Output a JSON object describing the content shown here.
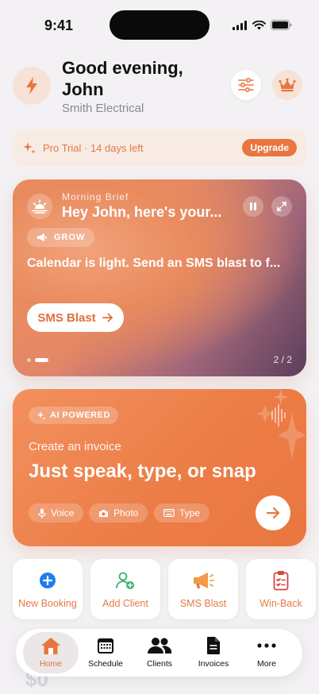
{
  "status": {
    "time": "9:41"
  },
  "header": {
    "greeting": "Good evening, John",
    "company": "Smith Electrical"
  },
  "trial": {
    "text": "Pro Trial · 14 days left",
    "upgrade": "Upgrade"
  },
  "brief": {
    "label": "Morning Brief",
    "title": "Hey John, here's your...",
    "tag": "GROW",
    "message": "Calendar is light. Send an SMS blast to f...",
    "button": "SMS Blast",
    "pager": "2 / 2"
  },
  "ai": {
    "badge": "AI POWERED",
    "subtitle": "Create an invoice",
    "title": "Just speak, type, or snap",
    "chips": [
      "Voice",
      "Photo",
      "Type"
    ]
  },
  "actions": [
    {
      "label": "New Booking",
      "icon": "plus-circle-icon"
    },
    {
      "label": "Add Client",
      "icon": "add-user-icon"
    },
    {
      "label": "SMS Blast",
      "icon": "megaphone-icon"
    },
    {
      "label": "Win-Back",
      "icon": "clipboard-icon"
    }
  ],
  "peek": {
    "amount": "$0"
  },
  "tabs": [
    {
      "label": "Home",
      "icon": "home-icon",
      "active": true
    },
    {
      "label": "Schedule",
      "icon": "calendar-icon"
    },
    {
      "label": "Clients",
      "icon": "users-icon"
    },
    {
      "label": "Invoices",
      "icon": "document-icon"
    },
    {
      "label": "More",
      "icon": "more-icon"
    }
  ],
  "colors": {
    "accent": "#e8763f",
    "background": "#f3f1f4",
    "add_client_green": "#3bb26b",
    "booking_blue": "#1e7ee8",
    "winback_red": "#d9453a"
  }
}
